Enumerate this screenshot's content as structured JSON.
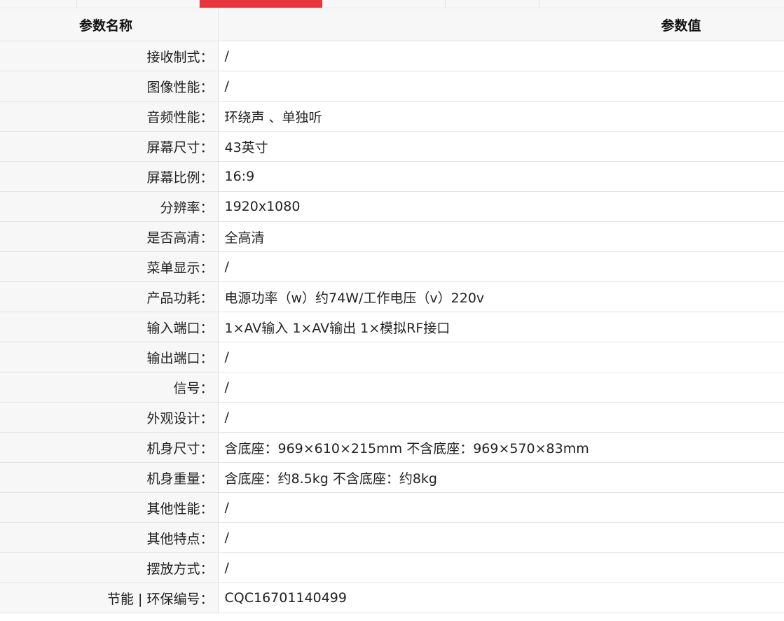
{
  "colors": {
    "active_tab": "#e8363c",
    "label_bg": "#f7f7f7",
    "border": "#e3e3e3",
    "text": "#222222"
  },
  "header": {
    "name_label": "参数名称",
    "value_label": "参数值"
  },
  "rows": [
    {
      "label": "接收制式：",
      "value": "/"
    },
    {
      "label": "图像性能：",
      "value": "/"
    },
    {
      "label": "音频性能：",
      "value": "环绕声 、单独听"
    },
    {
      "label": "屏幕尺寸：",
      "value": "43英寸"
    },
    {
      "label": "屏幕比例：",
      "value": "16:9"
    },
    {
      "label": "分辨率：",
      "value": "1920x1080"
    },
    {
      "label": "是否高清：",
      "value": "全高清"
    },
    {
      "label": "菜单显示：",
      "value": "/"
    },
    {
      "label": "产品功耗：",
      "value": "电源功率（w）约74W/工作电压（v）220v"
    },
    {
      "label": "输入端口：",
      "value": "1×AV输入 1×AV输出 1×模拟RF接口"
    },
    {
      "label": "输出端口：",
      "value": "/"
    },
    {
      "label": "信号：",
      "value": "/"
    },
    {
      "label": "外观设计：",
      "value": "/"
    },
    {
      "label": "机身尺寸：",
      "value": "含底座：969×610×215mm 不含底座：969×570×83mm"
    },
    {
      "label": "机身重量：",
      "value": "含底座：约8.5kg 不含底座：约8kg"
    },
    {
      "label": "其他性能：",
      "value": "/"
    },
    {
      "label": "其他特点：",
      "value": "/"
    },
    {
      "label": "摆放方式：",
      "value": "/"
    },
    {
      "label": "节能 | 环保编号：",
      "value": "CQC16701140499"
    }
  ]
}
